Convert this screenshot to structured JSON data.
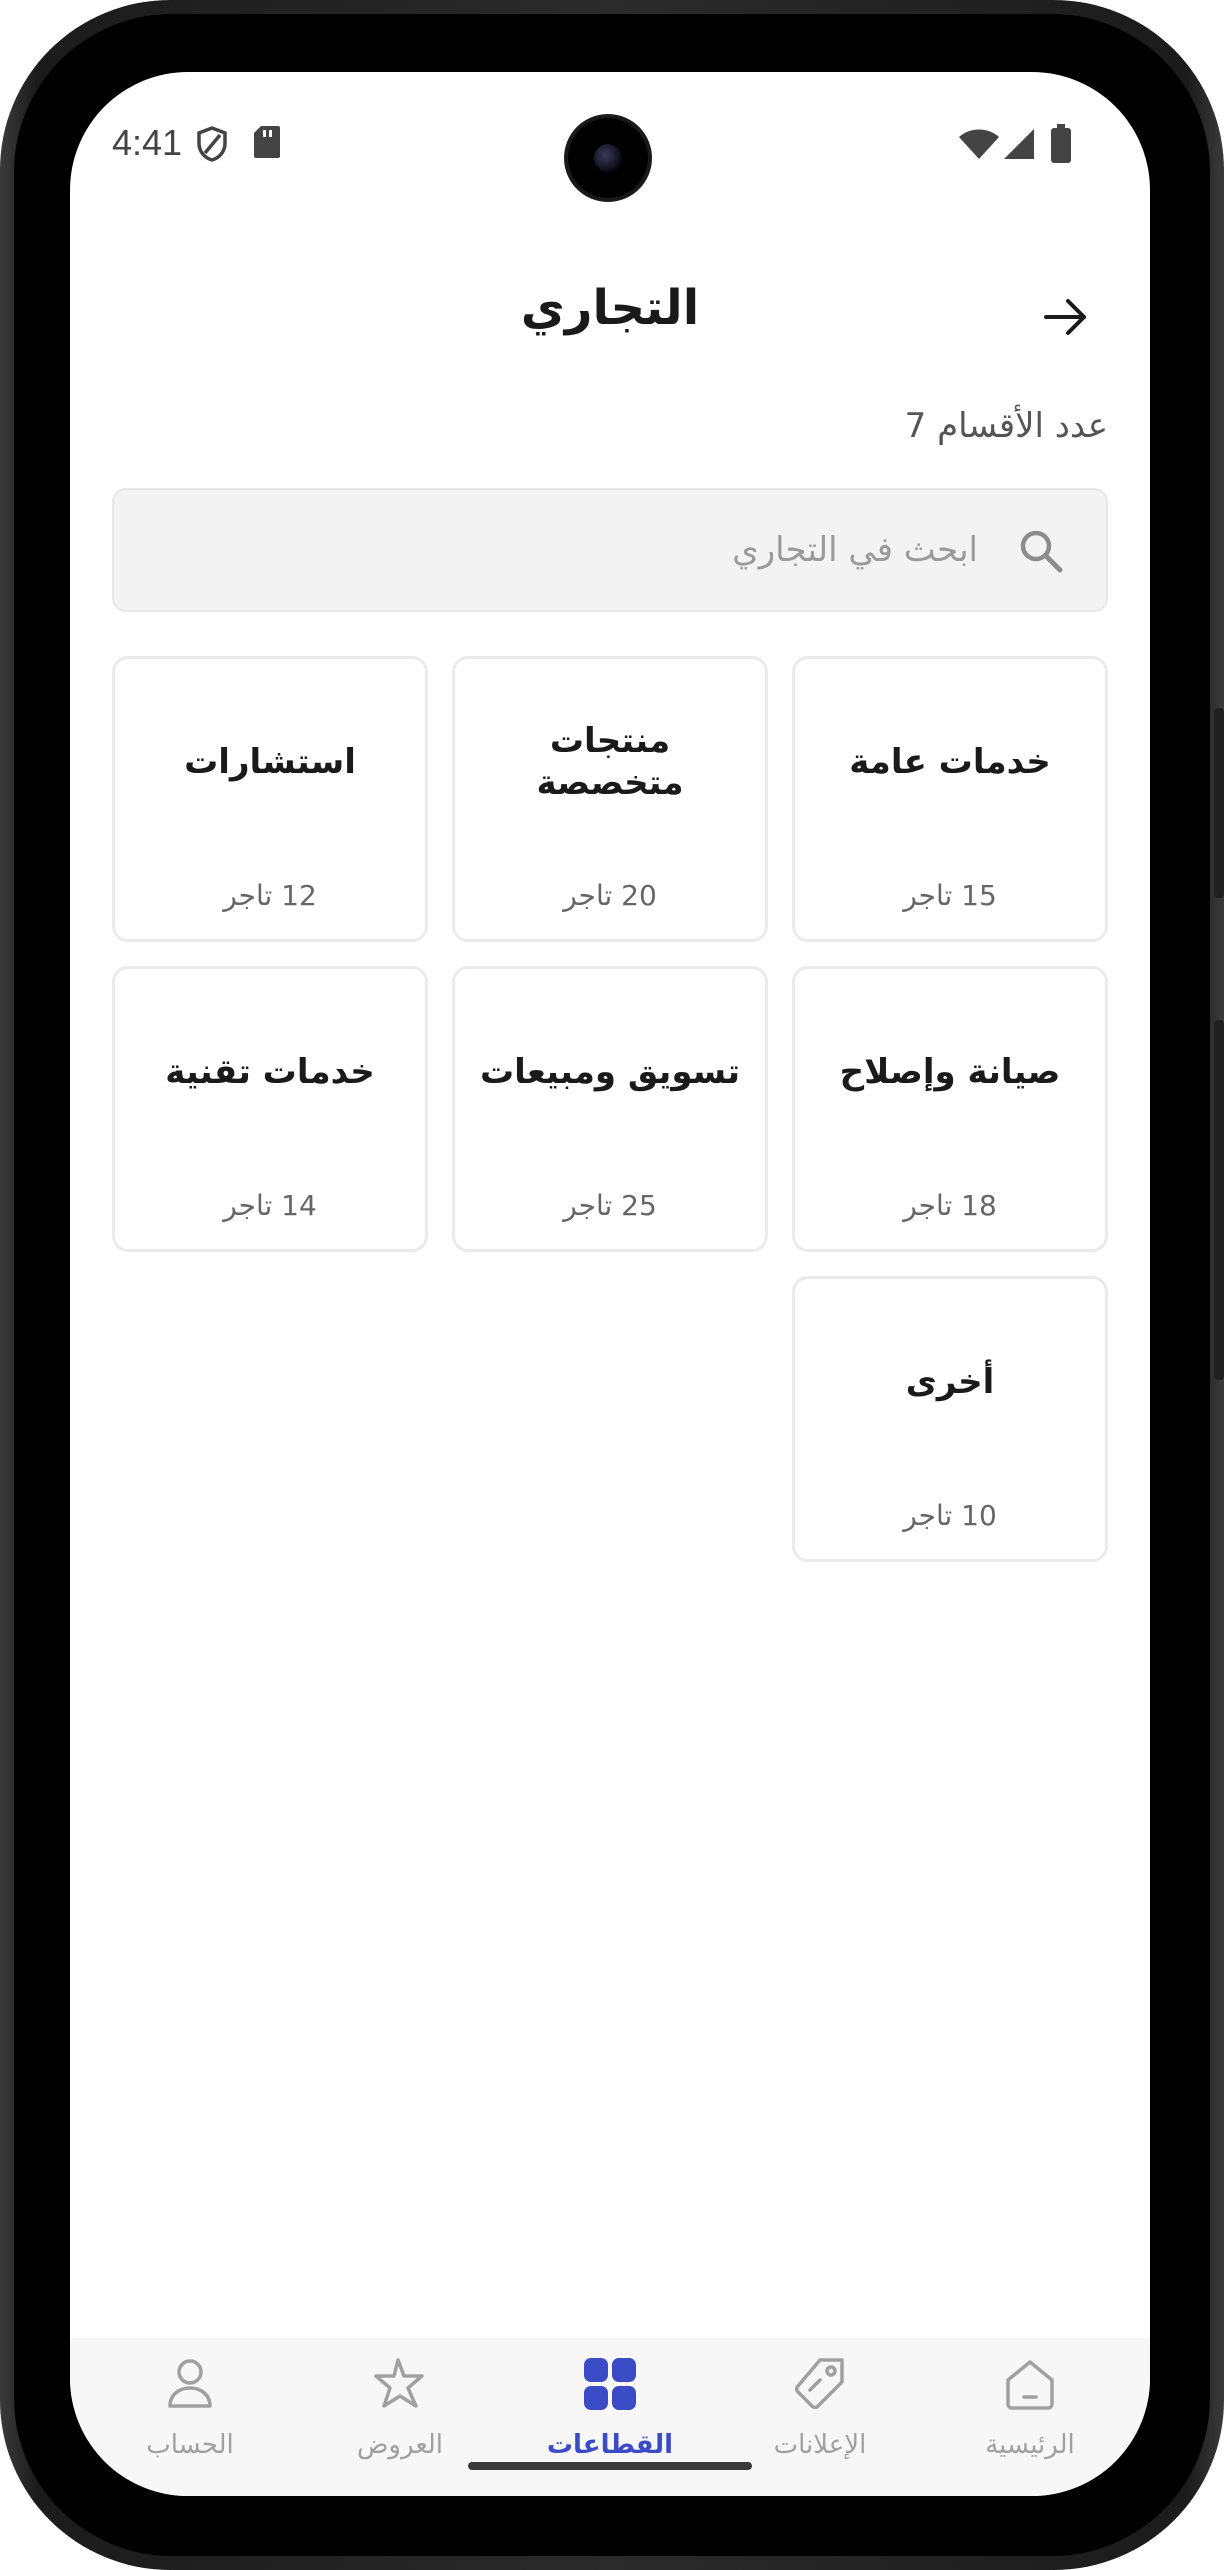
{
  "status_bar": {
    "time": "4:41"
  },
  "header": {
    "title": "التجاري"
  },
  "sections_count_text": "عدد الأقسام 7",
  "search": {
    "placeholder": "ابحث في التجاري",
    "value": ""
  },
  "categories": [
    {
      "name": "خدمات عامة",
      "count": "15 تاجر"
    },
    {
      "name": "منتجات متخصصة",
      "count": "20 تاجر"
    },
    {
      "name": "استشارات",
      "count": "12 تاجر"
    },
    {
      "name": "صيانة وإصلاح",
      "count": "18 تاجر"
    },
    {
      "name": "تسويق ومبيعات",
      "count": "25 تاجر"
    },
    {
      "name": "خدمات تقنية",
      "count": "14 تاجر"
    },
    {
      "name": "أخرى",
      "count": "10 تاجر"
    }
  ],
  "bottom_nav": {
    "items": [
      {
        "label": "الرئيسية",
        "icon": "home-icon",
        "active": false
      },
      {
        "label": "الإعلانات",
        "icon": "tag-icon",
        "active": false
      },
      {
        "label": "القطاعات",
        "icon": "grid-icon",
        "active": true
      },
      {
        "label": "العروض",
        "icon": "star-icon",
        "active": false
      },
      {
        "label": "الحساب",
        "icon": "user-icon",
        "active": false
      }
    ]
  },
  "colors": {
    "accent": "#3b4bc6",
    "text_primary": "#1a1a1a",
    "text_muted": "#a0a0a0",
    "card_border": "#ebebeb",
    "search_bg": "#f3f3f3"
  }
}
